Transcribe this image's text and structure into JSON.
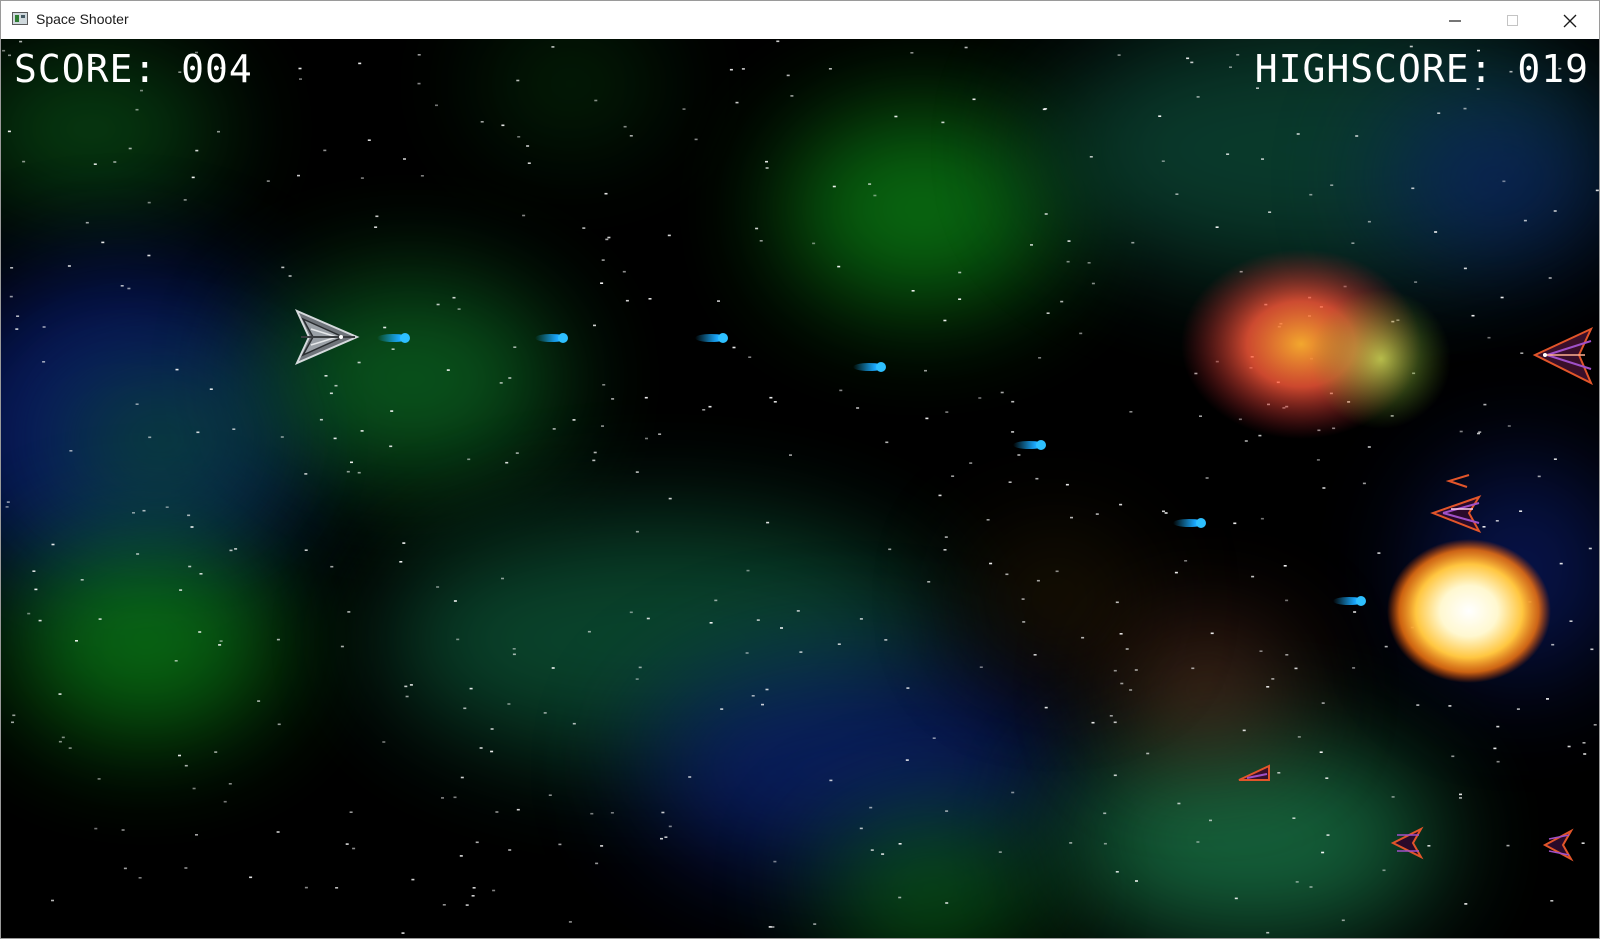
{
  "window": {
    "title": "Space Shooter",
    "icon": "app-window-icon",
    "controls": [
      "minimize-icon",
      "maximize-icon",
      "close-icon"
    ]
  },
  "hud": {
    "score_text": "SCORE: 004",
    "highscore_text": "HIGHSCORE: 019",
    "score": 4,
    "highscore": 19
  },
  "scene": {
    "player_ship": "silver-fighter-icon",
    "projectile": "blue-plasma-bolt-icon",
    "projectile_count": 7,
    "enemy_ship": "red-purple-enemy-ship-icon",
    "explosion": "explosion-fireball-icon",
    "colors": {
      "space": "#000000",
      "nebula_green": "#0a7a14",
      "nebula_blue": "#0b1f6e",
      "plasma": "#19b4ff",
      "hud_text": "#ffffff"
    }
  }
}
